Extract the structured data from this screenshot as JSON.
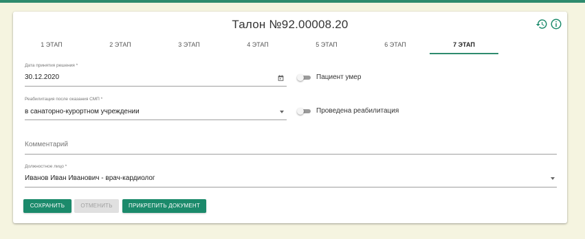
{
  "header": {
    "title": "Талон №92.00008.20",
    "history_icon": "history-icon",
    "info_icon": "info-icon"
  },
  "tabs": [
    {
      "label": "1 ЭТАП",
      "active": false
    },
    {
      "label": "2 ЭТАП",
      "active": false
    },
    {
      "label": "3 ЭТАП",
      "active": false
    },
    {
      "label": "4 ЭТАП",
      "active": false
    },
    {
      "label": "5 ЭТАП",
      "active": false
    },
    {
      "label": "6 ЭТАП",
      "active": false
    },
    {
      "label": "7 ЭТАП",
      "active": true
    }
  ],
  "form": {
    "decision_date": {
      "label": "Дата принятия решения *",
      "value": "30.12.2020",
      "icon": "calendar-icon"
    },
    "patient_died": {
      "label": "Пациент умер",
      "checked": false
    },
    "rehab_after_smp": {
      "label": "Реабилитация после оказания СМП *",
      "value": "в санаторно-курортном учреждении"
    },
    "rehab_done": {
      "label": "Проведена реабилитация",
      "checked": false
    },
    "comment": {
      "placeholder": "Комментарий",
      "value": ""
    },
    "official": {
      "label": "Должностное лицо *",
      "value": "Иванов  Иван  Иванович  - врач-кардиолог"
    }
  },
  "buttons": {
    "save": "СОХРАНИТЬ",
    "cancel": "ОТМЕНИТЬ",
    "attach": "ПРИКРЕПИТЬ ДОКУМЕНТ"
  },
  "colors": {
    "accent": "#1b8a6b",
    "background": "#f5f4e0",
    "disabled": "#e0e0e0"
  }
}
